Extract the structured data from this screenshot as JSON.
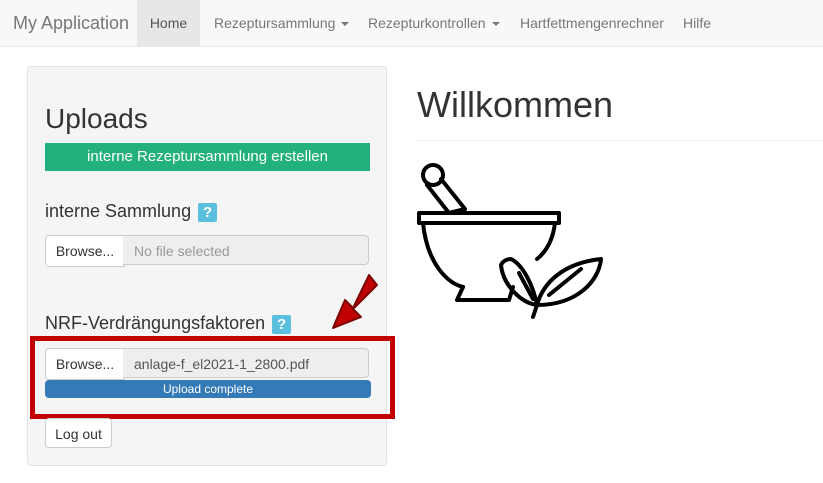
{
  "navbar": {
    "brand": "My Application",
    "items": [
      {
        "label": "Home",
        "active": true,
        "dropdown": false
      },
      {
        "label": "Rezeptursammlung",
        "active": false,
        "dropdown": true
      },
      {
        "label": "Rezepturkontrollen",
        "active": false,
        "dropdown": true
      },
      {
        "label": "Hartfettmengenrechner",
        "active": false,
        "dropdown": false
      },
      {
        "label": "Hilfe",
        "active": false,
        "dropdown": false
      }
    ]
  },
  "sidebar": {
    "title": "Uploads",
    "create_button": "interne Rezeptursammlung erstellen",
    "internal": {
      "label": "interne Sammlung",
      "help": "?",
      "browse": "Browse...",
      "placeholder": "No file selected"
    },
    "nrf": {
      "label": "NRF-Verdrängungsfaktoren",
      "help": "?",
      "browse": "Browse...",
      "filename": "anlage-f_el2021-1_2800.pdf",
      "progress_text": "Upload complete",
      "progress_value": 1.0
    },
    "logout": "Log out"
  },
  "main": {
    "title": "Willkommen",
    "image_icon": "mortar-pestle-leaves-icon"
  },
  "colors": {
    "primary_green": "#22b07d",
    "progress_blue": "#337ab7",
    "help_blue": "#5bc0de",
    "highlight_red": "#c00000"
  }
}
